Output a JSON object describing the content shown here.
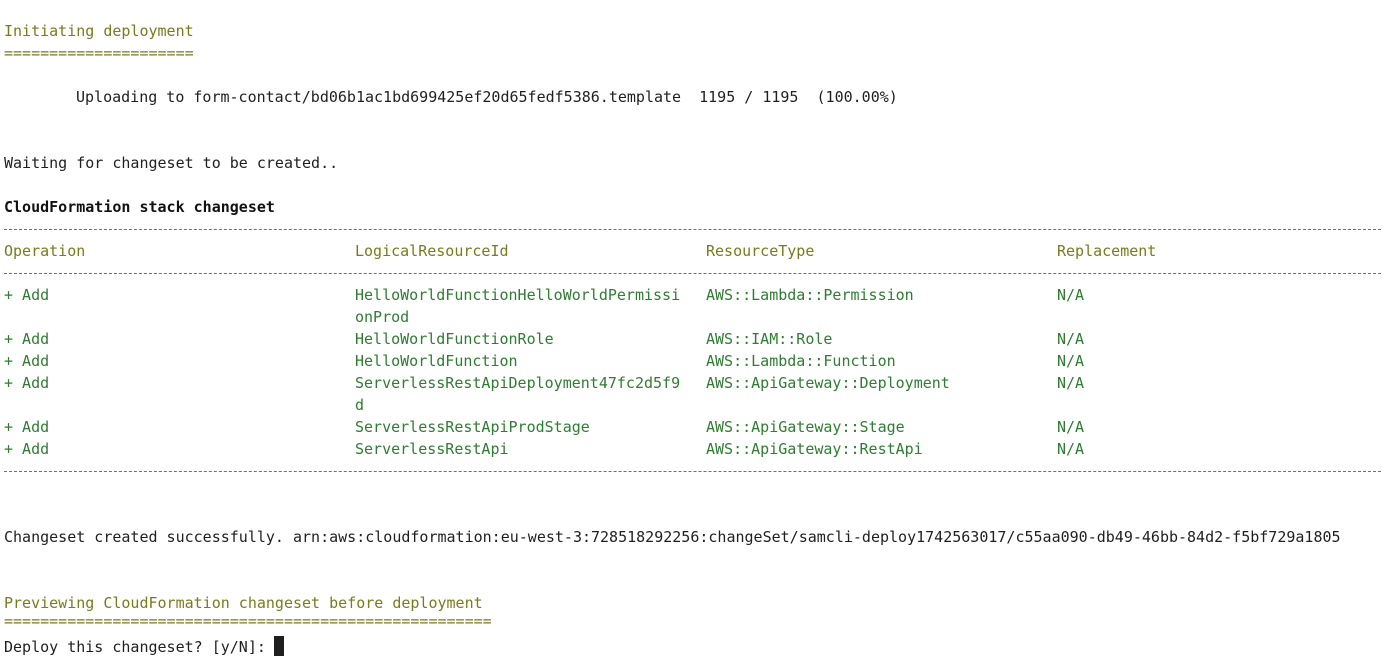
{
  "terminal": {
    "initiating": "Initiating deployment",
    "initiating_underline": "=====================",
    "uploading": "Uploading to form-contact/bd06b1ac1bd699425ef20d65fedf5386.template  1195 / 1195  (100.00%)",
    "waiting": "Waiting for changeset to be created..",
    "changeset_title": "CloudFormation stack changeset",
    "separator": "------------------------------------------------------------------------------------------------------------------------------------------------------------------------",
    "table": {
      "headers": [
        "Operation",
        "LogicalResourceId",
        "ResourceType",
        "Replacement"
      ],
      "rows": [
        {
          "op": "+ Add",
          "id": "HelloWorldFunctionHelloWorldPermissi",
          "id2": "onProd",
          "type": "AWS::Lambda::Permission",
          "repl": "N/A"
        },
        {
          "op": "+ Add",
          "id": "HelloWorldFunctionRole",
          "id2": "",
          "type": "AWS::IAM::Role",
          "repl": "N/A"
        },
        {
          "op": "+ Add",
          "id": "HelloWorldFunction",
          "id2": "",
          "type": "AWS::Lambda::Function",
          "repl": "N/A"
        },
        {
          "op": "+ Add",
          "id": "ServerlessRestApiDeployment47fc2d5f9",
          "id2": "d",
          "type": "AWS::ApiGateway::Deployment",
          "repl": "N/A"
        },
        {
          "op": "+ Add",
          "id": "ServerlessRestApiProdStage",
          "id2": "",
          "type": "AWS::ApiGateway::Stage",
          "repl": "N/A"
        },
        {
          "op": "+ Add",
          "id": "ServerlessRestApi",
          "id2": "",
          "type": "AWS::ApiGateway::RestApi",
          "repl": "N/A"
        }
      ]
    },
    "created": "Changeset created successfully. arn:aws:cloudformation:eu-west-3:728518292256:changeSet/samcli-deploy1742563017/c55aa090-db49-46bb-84d2-f5bf729a1805",
    "previewing": "Previewing CloudFormation changeset before deployment",
    "previewing_underline": "======================================================",
    "prompt": "Deploy this changeset? [y/N]: ",
    "colors": {
      "olive": "#7a7a1e",
      "green": "#2f7d32",
      "text": "#1f1f1f"
    }
  }
}
